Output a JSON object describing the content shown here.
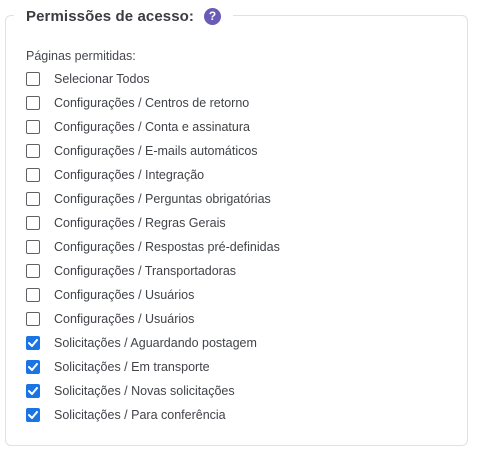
{
  "access": {
    "legend": "Permissões de acesso:",
    "help_icon": "question-mark-icon",
    "help_glyph": "?",
    "pages_label": "Páginas permitidas:",
    "accent_color": "#6a5bb7",
    "check_color": "#1b74e4",
    "items": [
      {
        "label": "Selecionar Todos",
        "checked": false
      },
      {
        "label": "Configurações / Centros de retorno",
        "checked": false
      },
      {
        "label": "Configurações / Conta e assinatura",
        "checked": false
      },
      {
        "label": "Configurações / E-mails automáticos",
        "checked": false
      },
      {
        "label": "Configurações / Integração",
        "checked": false
      },
      {
        "label": "Configurações / Perguntas obrigatórias",
        "checked": false
      },
      {
        "label": "Configurações / Regras Gerais",
        "checked": false
      },
      {
        "label": "Configurações / Respostas pré-definidas",
        "checked": false
      },
      {
        "label": "Configurações / Transportadoras",
        "checked": false
      },
      {
        "label": "Configurações / Usuários",
        "checked": false
      },
      {
        "label": "Configurações / Usuários",
        "checked": false
      },
      {
        "label": "Solicitações / Aguardando postagem",
        "checked": true
      },
      {
        "label": "Solicitações / Em transporte",
        "checked": true
      },
      {
        "label": "Solicitações / Novas solicitações",
        "checked": true
      },
      {
        "label": "Solicitações / Para conferência",
        "checked": true
      }
    ]
  }
}
